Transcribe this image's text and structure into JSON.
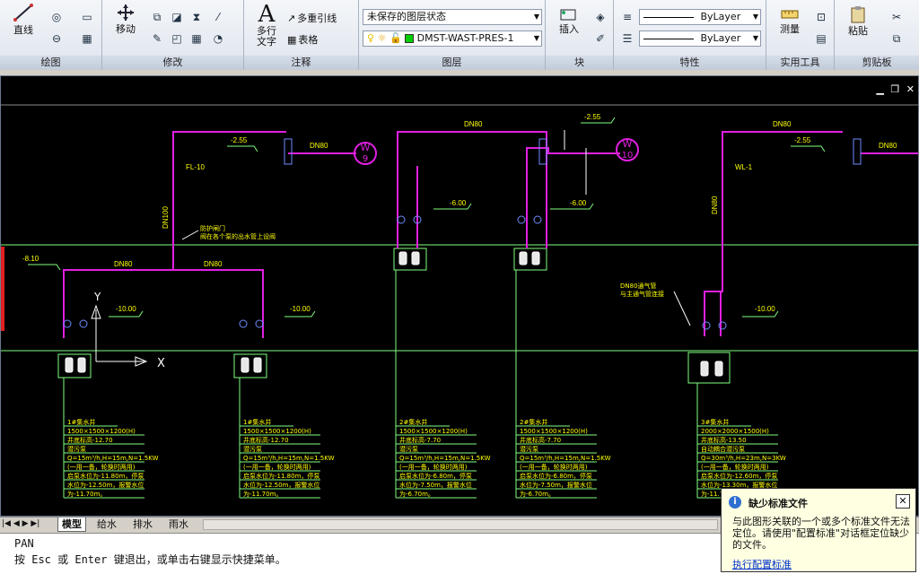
{
  "ribbon": {
    "panels": [
      {
        "id": "draw",
        "title": "绘图"
      },
      {
        "id": "modify",
        "title": "修改"
      },
      {
        "id": "annotation",
        "title": "注释"
      },
      {
        "id": "layers",
        "title": "图层"
      },
      {
        "id": "block",
        "title": "块"
      },
      {
        "id": "properties",
        "title": "特性"
      },
      {
        "id": "utilities",
        "title": "实用工具"
      },
      {
        "id": "clipboard",
        "title": "剪贴板"
      }
    ],
    "draw": {
      "line_label": "直线"
    },
    "modify": {
      "move_label": "移动"
    },
    "annotation": {
      "mtext_label": "多行\n文字",
      "mleader_label": "多重引线",
      "table_label": "表格"
    },
    "layers": {
      "state_value": "未保存的图层状态",
      "layer_value": "DMST-WAST-PRES-1"
    },
    "block": {
      "insert_label": "插入"
    },
    "properties": {
      "linetype_value": "ByLayer",
      "lineweight_value": "ByLayer"
    },
    "utilities": {
      "measure_label": "测量"
    },
    "clipboard": {
      "paste_label": "粘贴"
    }
  },
  "drawing": {
    "pipe_labels": [
      "DN80",
      "DN100",
      "DN80",
      "DN80",
      "DN80",
      "DN80",
      "DN80",
      "DN80"
    ],
    "elevations": [
      "-2.55",
      "-2.55",
      "-2.55",
      "-8.10",
      "-6.00",
      "-6.00",
      "-10.00",
      "-10.00",
      "-10.00"
    ],
    "wells": [
      {
        "letter": "W",
        "num": "9"
      },
      {
        "letter": "W",
        "num": "10"
      }
    ],
    "codes": [
      "FL-10",
      "WL-1"
    ],
    "note1": "防护闸门\n阀在各个泵的出水管上设阀",
    "note2": "DN80通气管\n与主通气管连接",
    "axis_x": "X",
    "axis_y": "Y",
    "pit_tables": [
      [
        "1#集水井",
        "1500×1500×1200(H)",
        "井底标高-12.70",
        "潜污泵",
        "Q=15m³/h,H=15m,N=1.5KW",
        "(一用一备，轮换时两用)",
        "启泵水位为-11.80m，停泵",
        "水位为-12.50m，报警水位",
        "为-11.70m。"
      ],
      [
        "1#集水井",
        "1500×1500×1200(H)",
        "井底标高-12.70",
        "潜污泵",
        "Q=15m³/h,H=15m,N=1.5KW",
        "(一用一备，轮换时两用)",
        "启泵水位为-11.80m，停泵",
        "水位为-12.50m，报警水位",
        "为-11.70m。"
      ],
      [
        "2#集水井",
        "1500×1500×1200(H)",
        "井底标高-7.70",
        "潜污泵",
        "Q=15m³/h,H=15m,N=1.5KW",
        "(一用一备，轮换时两用)",
        "启泵水位为-6.80m，停泵",
        "水位为-7.50m，报警水位",
        "为-6.70m。"
      ],
      [
        "2#集水井",
        "1500×1500×1200(H)",
        "井底标高-7.70",
        "潜污泵",
        "Q=15m³/h,H=15m,N=1.5KW",
        "(一用一备，轮换时两用)",
        "启泵水位为-6.80m，停泵",
        "水位为-7.50m，报警水位",
        "为-6.70m。"
      ],
      [
        "3#集水井",
        "2000×2000×1500(H)",
        "井底标高-13.50",
        "自动耦合潜污泵",
        "Q=30m³/h,H=23m,N=3KW",
        "(一用一备，轮换时两用)",
        "启泵水位为-12.60m，停泵",
        "水位为-13.30m，报警水位",
        "为-11.70m。"
      ]
    ]
  },
  "tabs": {
    "items": [
      "模型",
      "给水",
      "排水",
      "雨水"
    ]
  },
  "command": {
    "line1": "PAN",
    "line2": "按 Esc 或 Enter 键退出，或单击右键显示快捷菜单。"
  },
  "balloon": {
    "title": "缺少标准文件",
    "body": "与此图形关联的一个或多个标准文件无法定位。请使用\"配置标准\"对话框定位缺少的文件。",
    "link": "执行配置标准"
  },
  "colors": {
    "canvas": "#000000",
    "pipe": "#e020e0",
    "line": "#80ff80",
    "text": "#ffff00",
    "white": "#ffffff"
  }
}
